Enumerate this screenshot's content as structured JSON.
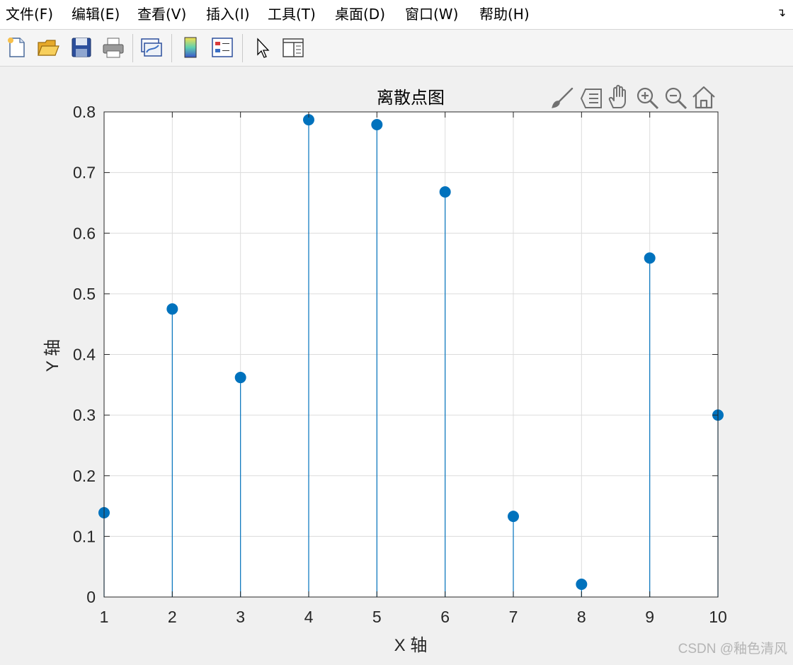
{
  "menu": {
    "items": [
      {
        "label": "文件(F)"
      },
      {
        "label": "编辑(E)"
      },
      {
        "label": "查看(V)"
      },
      {
        "label": "插入(I)"
      },
      {
        "label": "工具(T)"
      },
      {
        "label": "桌面(D)"
      },
      {
        "label": "窗口(W)"
      },
      {
        "label": "帮助(H)"
      }
    ],
    "corner_icon": "dock-arrow-icon"
  },
  "toolbar": {
    "buttons": [
      {
        "icon": "new-figure-icon"
      },
      {
        "icon": "open-file-icon"
      },
      {
        "icon": "save-icon"
      },
      {
        "icon": "print-icon"
      },
      {
        "icon": "link-plot-icon"
      },
      {
        "icon": "insert-colorbar-icon"
      },
      {
        "icon": "insert-legend-icon"
      },
      {
        "icon": "edit-plot-arrow-icon"
      },
      {
        "icon": "property-inspector-icon"
      }
    ]
  },
  "axes_toolbar": {
    "buttons": [
      {
        "icon": "brush-icon"
      },
      {
        "icon": "data-tips-icon"
      },
      {
        "icon": "pan-hand-icon"
      },
      {
        "icon": "zoom-in-icon"
      },
      {
        "icon": "zoom-out-icon"
      },
      {
        "icon": "restore-view-home-icon"
      }
    ]
  },
  "chart_data": {
    "type": "stem",
    "title": "离散点图",
    "xlabel": "X 轴",
    "ylabel": "Y 轴",
    "x": [
      1,
      2,
      3,
      4,
      5,
      6,
      7,
      8,
      9,
      10
    ],
    "values": [
      0.139,
      0.475,
      0.362,
      0.787,
      0.779,
      0.668,
      0.133,
      0.021,
      0.559,
      0.3
    ],
    "xlim": [
      1,
      10
    ],
    "ylim": [
      0,
      0.8
    ],
    "xticks": [
      "1",
      "2",
      "3",
      "4",
      "5",
      "6",
      "7",
      "8",
      "9",
      "10"
    ],
    "yticks": [
      "0",
      "0.1",
      "0.2",
      "0.3",
      "0.4",
      "0.5",
      "0.6",
      "0.7",
      "0.8"
    ],
    "grid": true,
    "color": "#0072BD"
  },
  "watermark": "CSDN @釉色清风"
}
